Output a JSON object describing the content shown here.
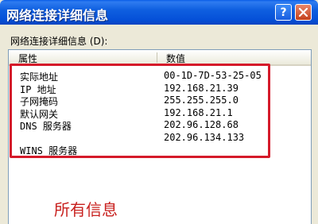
{
  "window": {
    "title": "网络连接详细信息",
    "help_button": "?",
    "close_button": "×"
  },
  "section": {
    "label": "网络连接详细信息 (D):"
  },
  "table": {
    "columns": [
      "属性",
      "数值"
    ],
    "rows": [
      {
        "property": "实际地址",
        "value": "00-1D-7D-53-25-05"
      },
      {
        "property": "IP 地址",
        "value": "192.168.21.39"
      },
      {
        "property": "子网掩码",
        "value": "255.255.255.0"
      },
      {
        "property": "默认网关",
        "value": "192.168.21.1"
      },
      {
        "property": "DNS 服务器",
        "value": "202.96.128.68"
      },
      {
        "property": "",
        "value": "202.96.134.133"
      },
      {
        "property": "WINS 服务器",
        "value": ""
      }
    ]
  },
  "annotation": {
    "text": "所有信息",
    "color": "#c8201e",
    "highlight_color": "#d51a2a"
  },
  "colors": {
    "titlebar": "#0550d8",
    "dialog_bg": "#ece9d8"
  }
}
